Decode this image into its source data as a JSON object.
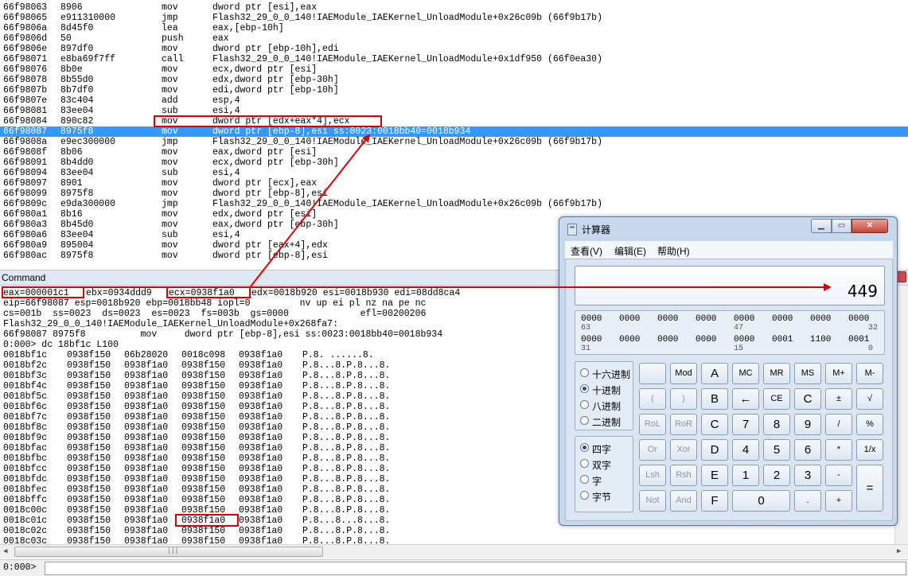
{
  "disassembly": [
    {
      "addr": "66f98063",
      "bytes": "8906",
      "mnemonic": "mov",
      "operands": "dword ptr [esi],eax"
    },
    {
      "addr": "66f98065",
      "bytes": "e911310000",
      "mnemonic": "jmp",
      "operands": "Flash32_29_0_0_140!IAEModule_IAEKernel_UnloadModule+0x26c09b (66f9b17b)"
    },
    {
      "addr": "66f9806a",
      "bytes": "8d45f0",
      "mnemonic": "lea",
      "operands": "eax,[ebp-10h]"
    },
    {
      "addr": "66f9806d",
      "bytes": "50",
      "mnemonic": "push",
      "operands": "eax"
    },
    {
      "addr": "66f9806e",
      "bytes": "897df0",
      "mnemonic": "mov",
      "operands": "dword ptr [ebp-10h],edi"
    },
    {
      "addr": "66f98071",
      "bytes": "e8ba69f7ff",
      "mnemonic": "call",
      "operands": "Flash32_29_0_0_140!IAEModule_IAEKernel_UnloadModule+0x1df950 (66f0ea30)"
    },
    {
      "addr": "66f98076",
      "bytes": "8b0e",
      "mnemonic": "mov",
      "operands": "ecx,dword ptr [esi]"
    },
    {
      "addr": "66f98078",
      "bytes": "8b55d0",
      "mnemonic": "mov",
      "operands": "edx,dword ptr [ebp-30h]"
    },
    {
      "addr": "66f9807b",
      "bytes": "8b7df0",
      "mnemonic": "mov",
      "operands": "edi,dword ptr [ebp-10h]"
    },
    {
      "addr": "66f9807e",
      "bytes": "83c404",
      "mnemonic": "add",
      "operands": "esp,4"
    },
    {
      "addr": "66f98081",
      "bytes": "83ee04",
      "mnemonic": "sub",
      "operands": "esi,4"
    },
    {
      "addr": "66f98084",
      "bytes": "890c82",
      "mnemonic": "mov",
      "operands": "dword ptr [edx+eax*4],ecx"
    },
    {
      "addr": "66f98087",
      "bytes": "8975f8",
      "mnemonic": "mov",
      "operands": "dword ptr [ebp-8],esi ss:0023:0018bb40=0018b934"
    },
    {
      "addr": "66f9808a",
      "bytes": "e9ec300000",
      "mnemonic": "jmp",
      "operands": "Flash32_29_0_0_140!IAEModule_IAEKernel_UnloadModule+0x26c09b (66f9b17b)"
    },
    {
      "addr": "66f9808f",
      "bytes": "8b06",
      "mnemonic": "mov",
      "operands": "eax,dword ptr [esi]"
    },
    {
      "addr": "66f98091",
      "bytes": "8b4dd0",
      "mnemonic": "mov",
      "operands": "ecx,dword ptr [ebp-30h]"
    },
    {
      "addr": "66f98094",
      "bytes": "83ee04",
      "mnemonic": "sub",
      "operands": "esi,4"
    },
    {
      "addr": "66f98097",
      "bytes": "8901",
      "mnemonic": "mov",
      "operands": "dword ptr [ecx],eax"
    },
    {
      "addr": "66f98099",
      "bytes": "8975f8",
      "mnemonic": "mov",
      "operands": "dword ptr [ebp-8],esi"
    },
    {
      "addr": "66f9809c",
      "bytes": "e9da300000",
      "mnemonic": "jmp",
      "operands": "Flash32_29_0_0_140!IAEModule_IAEKernel_UnloadModule+0x26c09b (66f9b17b)"
    },
    {
      "addr": "66f980a1",
      "bytes": "8b16",
      "mnemonic": "mov",
      "operands": "edx,dword ptr [esi]"
    },
    {
      "addr": "66f980a3",
      "bytes": "8b45d0",
      "mnemonic": "mov",
      "operands": "eax,dword ptr [ebp-30h]"
    },
    {
      "addr": "66f980a6",
      "bytes": "83ee04",
      "mnemonic": "sub",
      "operands": "esi,4"
    },
    {
      "addr": "66f980a9",
      "bytes": "895004",
      "mnemonic": "mov",
      "operands": "dword ptr [eax+4],edx"
    },
    {
      "addr": "66f980ac",
      "bytes": "8975f8",
      "mnemonic": "mov",
      "operands": "dword ptr [ebp-8],esi"
    }
  ],
  "command": {
    "title": "Command",
    "prompt": "0:000>",
    "input_value": "",
    "registers": {
      "eax": "eax=000001c1",
      "ebx": "ebx=0934ddd9",
      "ecx": "ecx=0938f1a0",
      "rest": "edx=0018b920 esi=0018b930 edi=08dd8ca4"
    },
    "lines": [
      "eip=66f98087 esp=0018b920 ebp=0018bb48 iopl=0         nv up ei pl nz na pe nc",
      "cs=001b  ss=0023  ds=0023  es=0023  fs=003b  gs=0000             efl=00200206",
      "Flash32_29_0_0_140!IAEModule_IAEKernel_UnloadModule+0x268fa7:",
      "66f98087 8975f8          mov     dword ptr [ebp-8],esi ss:0023:0018bb40=0018b934",
      "0:000> dc 18bf1c L100"
    ],
    "memory": [
      {
        "addr": "0018bf1c",
        "v1": "0938f150",
        "v2": "06b28020",
        "v3": "0018c098",
        "v4": "0938f1a0",
        "ascii": "P.8. ......8."
      },
      {
        "addr": "0018bf2c",
        "v1": "0938f150",
        "v2": "0938f1a0",
        "v3": "0938f150",
        "v4": "0938f1a0",
        "ascii": "P.8...8.P.8...8."
      },
      {
        "addr": "0018bf3c",
        "v1": "0938f150",
        "v2": "0938f1a0",
        "v3": "0938f150",
        "v4": "0938f1a0",
        "ascii": "P.8...8.P.8...8."
      },
      {
        "addr": "0018bf4c",
        "v1": "0938f150",
        "v2": "0938f1a0",
        "v3": "0938f150",
        "v4": "0938f1a0",
        "ascii": "P.8...8.P.8...8."
      },
      {
        "addr": "0018bf5c",
        "v1": "0938f150",
        "v2": "0938f1a0",
        "v3": "0938f150",
        "v4": "0938f1a0",
        "ascii": "P.8...8.P.8...8."
      },
      {
        "addr": "0018bf6c",
        "v1": "0938f150",
        "v2": "0938f1a0",
        "v3": "0938f150",
        "v4": "0938f1a0",
        "ascii": "P.8...8.P.8...8."
      },
      {
        "addr": "0018bf7c",
        "v1": "0938f150",
        "v2": "0938f1a0",
        "v3": "0938f150",
        "v4": "0938f1a0",
        "ascii": "P.8...8.P.8...8."
      },
      {
        "addr": "0018bf8c",
        "v1": "0938f150",
        "v2": "0938f1a0",
        "v3": "0938f150",
        "v4": "0938f1a0",
        "ascii": "P.8...8.P.8...8."
      },
      {
        "addr": "0018bf9c",
        "v1": "0938f150",
        "v2": "0938f1a0",
        "v3": "0938f150",
        "v4": "0938f1a0",
        "ascii": "P.8...8.P.8...8."
      },
      {
        "addr": "0018bfac",
        "v1": "0938f150",
        "v2": "0938f1a0",
        "v3": "0938f150",
        "v4": "0938f1a0",
        "ascii": "P.8...8.P.8...8."
      },
      {
        "addr": "0018bfbc",
        "v1": "0938f150",
        "v2": "0938f1a0",
        "v3": "0938f150",
        "v4": "0938f1a0",
        "ascii": "P.8...8.P.8...8."
      },
      {
        "addr": "0018bfcc",
        "v1": "0938f150",
        "v2": "0938f1a0",
        "v3": "0938f150",
        "v4": "0938f1a0",
        "ascii": "P.8...8.P.8...8."
      },
      {
        "addr": "0018bfdc",
        "v1": "0938f150",
        "v2": "0938f1a0",
        "v3": "0938f150",
        "v4": "0938f1a0",
        "ascii": "P.8...8.P.8...8."
      },
      {
        "addr": "0018bfec",
        "v1": "0938f150",
        "v2": "0938f1a0",
        "v3": "0938f150",
        "v4": "0938f1a0",
        "ascii": "P.8...8.P.8...8."
      },
      {
        "addr": "0018bffc",
        "v1": "0938f150",
        "v2": "0938f1a0",
        "v3": "0938f150",
        "v4": "0938f1a0",
        "ascii": "P.8...8.P.8...8."
      },
      {
        "addr": "0018c00c",
        "v1": "0938f150",
        "v2": "0938f1a0",
        "v3": "0938f150",
        "v4": "0938f1a0",
        "ascii": "P.8...8.P.8...8."
      },
      {
        "addr": "0018c01c",
        "v1": "0938f150",
        "v2": "0938f1a0",
        "v3": "0938f1a0",
        "v4": "0938f1a0",
        "ascii": "P.8...8...8...8."
      },
      {
        "addr": "0018c02c",
        "v1": "0938f150",
        "v2": "0938f1a0",
        "v3": "0938f150",
        "v4": "0938f1a0",
        "ascii": "P.8...8.P.8...8."
      },
      {
        "addr": "0018c03c",
        "v1": "0938f150",
        "v2": "0938f1a0",
        "v3": "0938f150",
        "v4": "0938f1a0",
        "ascii": "P.8...8.P.8...8."
      }
    ]
  },
  "calculator": {
    "title": "计算器",
    "menu": [
      "查看(V)",
      "编辑(E)",
      "帮助(H)"
    ],
    "display": "449",
    "bits": {
      "row1": [
        "0000",
        "0000",
        "0000",
        "0000",
        "0000",
        "0000",
        "0000",
        "0000"
      ],
      "row1_idx": [
        "63",
        "47",
        "32"
      ],
      "row2": [
        "0000",
        "0000",
        "0000",
        "0000",
        "0000",
        "0001",
        "1100",
        "0001"
      ],
      "row2_idx": [
        "31",
        "15",
        "0"
      ]
    },
    "base_options": [
      "十六进制",
      "十进制",
      "八进制",
      "二进制"
    ],
    "base_selected": 1,
    "word_options": [
      "四字",
      "双字",
      "字",
      "字节"
    ],
    "word_selected": 0,
    "keys": [
      [
        "",
        "Mod",
        "A",
        "MC",
        "MR",
        "MS",
        "M+",
        "M-"
      ],
      [
        "(",
        ")",
        "B",
        "←",
        "CE",
        "C",
        "±",
        "√"
      ],
      [
        "RoL",
        "RoR",
        "C",
        "7",
        "8",
        "9",
        "/",
        "%"
      ],
      [
        "Or",
        "Xor",
        "D",
        "4",
        "5",
        "6",
        "*",
        "1/x"
      ],
      [
        "Lsh",
        "Rsh",
        "E",
        "1",
        "2",
        "3",
        "-",
        "="
      ],
      [
        "Not",
        "And",
        "F",
        "0",
        "",
        ".",
        "+",
        ""
      ]
    ]
  },
  "colors": {
    "selection": "#3399ff",
    "annotation": "#e10000"
  }
}
